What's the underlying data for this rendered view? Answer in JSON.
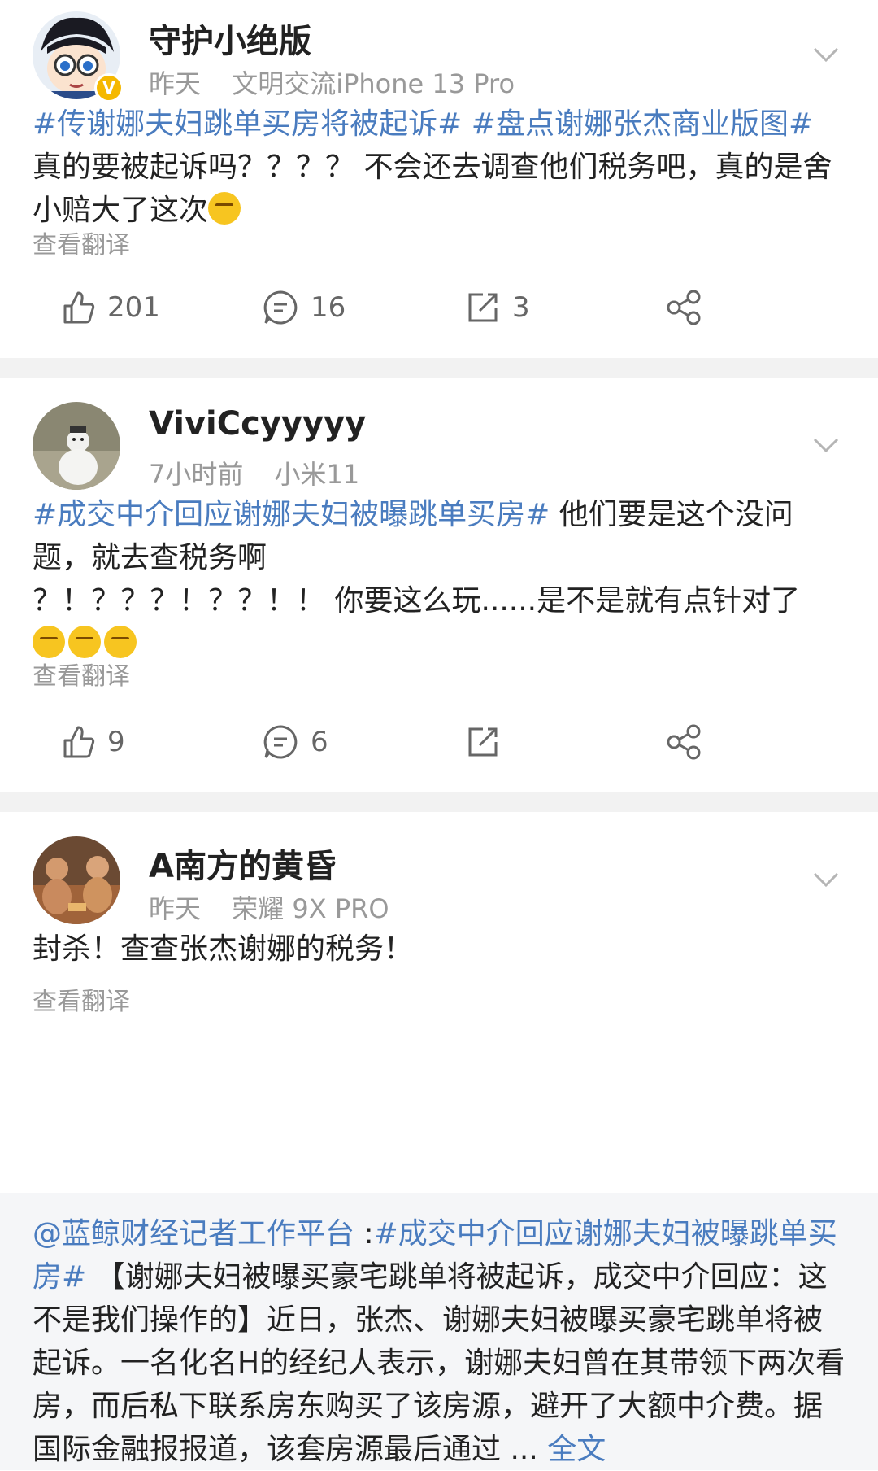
{
  "posts": [
    {
      "username": "守护小绝版",
      "time": "昨天",
      "device": "文明交流iPhone 13 Pro",
      "verified_badge": "V",
      "tags": [
        "#传谢娜夫妇跳单买房将被起诉#",
        "#盘点谢娜张杰商业版图#"
      ],
      "text": "真的要被起诉吗？？？？ 不会还去调查他们税务吧，真的是舍小赔大了这次",
      "translate": "查看翻译",
      "likes": "201",
      "comments": "16",
      "reposts": "3"
    },
    {
      "username": "ViviCcyyyyy",
      "time": "7小时前",
      "device": "小米11",
      "tags": [
        "#成交中介回应谢娜夫妇被曝跳单买房#"
      ],
      "text": " 他们要是这个没问题，就去查税务啊",
      "text2": "？！？？？！？？！！ 你要这么玩......是不是就有点针对了",
      "translate": "查看翻译",
      "likes": "9",
      "comments": "6",
      "reposts": ""
    },
    {
      "username": "A南方的黄昏",
      "time": "昨天",
      "device": "荣耀 9X PRO",
      "text": "封杀！查查张杰谢娜的税务！",
      "translate": "查看翻译"
    }
  ],
  "repost_card": {
    "mention": "@蓝鲸财经记者工作平台",
    "colon": " :",
    "tag": "#成交中介回应谢娜夫妇被曝跳单买房#",
    "body": " 【谢娜夫妇被曝买豪宅跳单将被起诉，成交中介回应：这不是我们操作的】近日，张杰、谢娜夫妇被曝买豪宅跳单将被起诉。一名化名H的经纪人表示，谢娜夫妇曾在其带领下两次看房，而后私下联系房东购买了该房源，避开了大额中介费。据国际金融报报道，该套房源最后通过",
    "ellipsis": " ... ",
    "full_text": "全文"
  },
  "icons": {
    "like": "thumbs-up-icon",
    "comment": "comment-bubble-icon",
    "repost": "repost-icon",
    "share": "share-icon",
    "chevron": "chevron-down-icon"
  },
  "colors": {
    "tag": "#4a7cbf",
    "meta": "#999999",
    "separator": "#f2f2f2"
  }
}
